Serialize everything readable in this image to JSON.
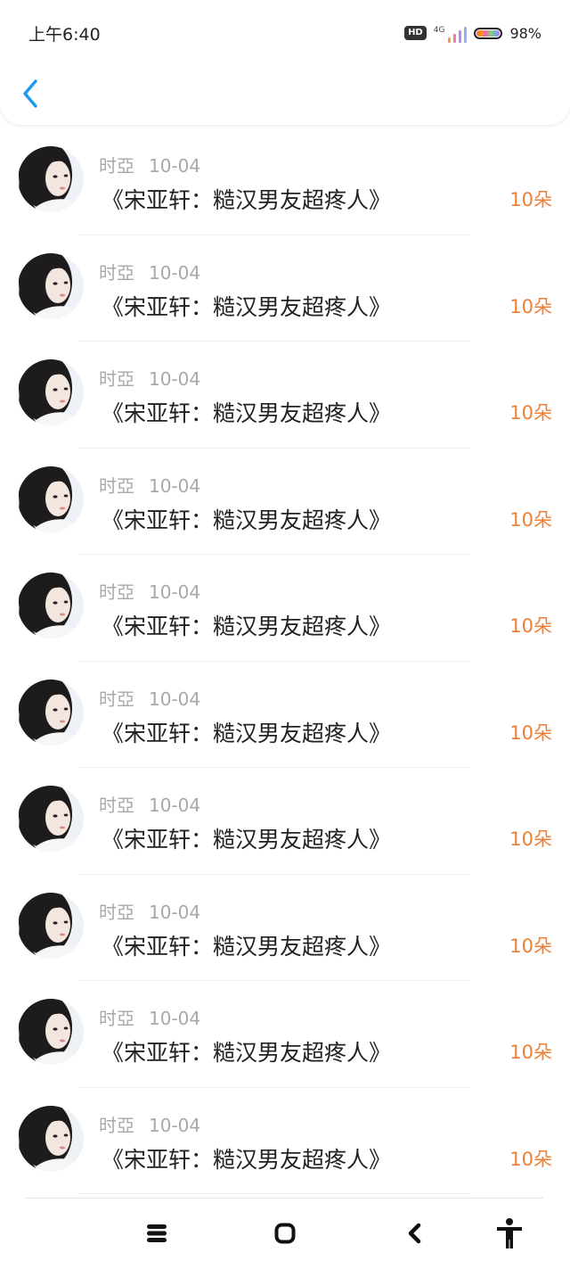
{
  "status_bar": {
    "time": "上午6:40",
    "hd": "HD",
    "network": "4G",
    "battery_percent": "98%",
    "battery_level": 0.98
  },
  "header": {
    "back_icon": "chevron-left-icon",
    "accent_color": "#1a9bf0"
  },
  "records": [
    {
      "user": "时亞",
      "date": "10-04",
      "title": "《宋亚轩：糙汉男友超疼人》",
      "amount": "10朵"
    },
    {
      "user": "时亞",
      "date": "10-04",
      "title": "《宋亚轩：糙汉男友超疼人》",
      "amount": "10朵"
    },
    {
      "user": "时亞",
      "date": "10-04",
      "title": "《宋亚轩：糙汉男友超疼人》",
      "amount": "10朵"
    },
    {
      "user": "时亞",
      "date": "10-04",
      "title": "《宋亚轩：糙汉男友超疼人》",
      "amount": "10朵"
    },
    {
      "user": "时亞",
      "date": "10-04",
      "title": "《宋亚轩：糙汉男友超疼人》",
      "amount": "10朵"
    },
    {
      "user": "时亞",
      "date": "10-04",
      "title": "《宋亚轩：糙汉男友超疼人》",
      "amount": "10朵"
    },
    {
      "user": "时亞",
      "date": "10-04",
      "title": "《宋亚轩：糙汉男友超疼人》",
      "amount": "10朵"
    },
    {
      "user": "时亞",
      "date": "10-04",
      "title": "《宋亚轩：糙汉男友超疼人》",
      "amount": "10朵"
    },
    {
      "user": "时亞",
      "date": "10-04",
      "title": "《宋亚轩：糙汉男友超疼人》",
      "amount": "10朵"
    },
    {
      "user": "时亞",
      "date": "10-04",
      "title": "《宋亚轩：糙汉男友超疼人》",
      "amount": "10朵"
    }
  ],
  "colors": {
    "amount": "#ef7f32",
    "meta_text": "#a8a8a8",
    "title_text": "#222222"
  },
  "nav_bar": {
    "icons": [
      "menu-icon",
      "home-icon",
      "back-icon",
      "accessibility-icon"
    ]
  }
}
